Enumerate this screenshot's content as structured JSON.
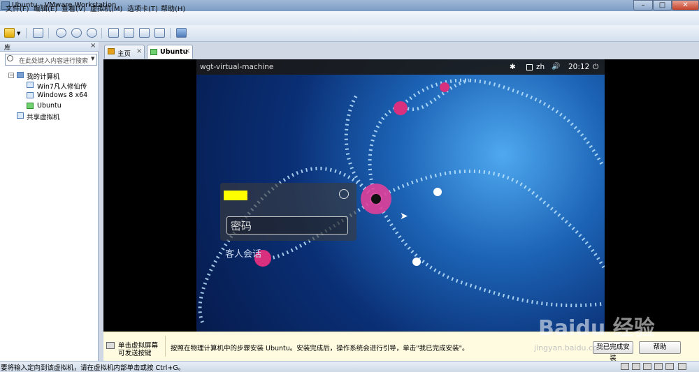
{
  "window": {
    "title": "Ubuntu - VMware Workstation",
    "min": "–",
    "max": "□",
    "close": "✕"
  },
  "menu": [
    "文件(F)",
    "编辑(E)",
    "查看(V)",
    "虚拟机(M)",
    "选项卡(T)",
    "帮助(H)"
  ],
  "library": {
    "title": "库",
    "close": "×",
    "search_placeholder": "在此处键入内容进行搜索",
    "tree": {
      "my_computer": "我的计算机",
      "vms": [
        "Win7凡人修仙传",
        "Windows 8 x64",
        "Ubuntu"
      ],
      "shared": "共享虚拟机"
    }
  },
  "tabs": [
    {
      "label": "主页",
      "icon": "home-icon"
    },
    {
      "label": "Ubuntu",
      "icon": "vm-icon"
    }
  ],
  "guest": {
    "hostname": "wgt-virtual-machine",
    "accessibility": "✱",
    "lang": "zh",
    "volume": "🔊",
    "time": "20:12",
    "power": "⏻",
    "password_placeholder": "密码",
    "guest_session": "客人会话"
  },
  "hint": {
    "left_line1": "单击虚拟屏幕",
    "left_line2": "可发送按键",
    "message": "按照在物理计算机中的步骤安装 Ubuntu。安装完成后，操作系统会进行引导，单击\"我已完成安装\"。",
    "done_button": "我已完成安装",
    "help_button": "帮助"
  },
  "status": "要将输入定向到该虚拟机，请在虚拟机内部单击或按 Ctrl+G。",
  "watermark": {
    "main": "Baidu 经验",
    "sub": "jingyan.baidu.com"
  },
  "colors": {
    "accent": "#7c9cc4",
    "highlight": "#ffff00"
  }
}
